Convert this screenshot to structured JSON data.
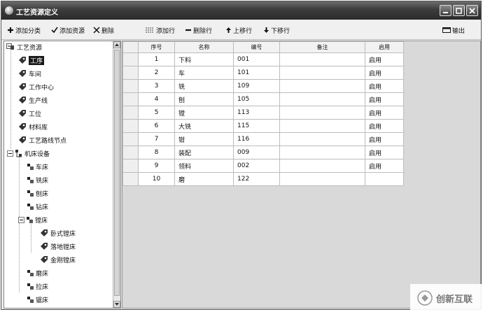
{
  "window": {
    "title": "工艺资源定义"
  },
  "toolbar": {
    "add_category": "添加分类",
    "add_resource": "添加资源",
    "delete": "删除",
    "add_row": "添加行",
    "delete_row": "删除行",
    "move_up": "上移行",
    "move_down": "下移行",
    "export": "输出"
  },
  "tree": {
    "root": "工艺资源",
    "nodes": [
      {
        "label": "工序",
        "selected": true
      },
      {
        "label": "车间"
      },
      {
        "label": "工作中心"
      },
      {
        "label": "生产线"
      },
      {
        "label": "工位"
      },
      {
        "label": "材料库"
      },
      {
        "label": "工艺路线节点"
      },
      {
        "label": "机床设备"
      },
      {
        "label": "车床"
      },
      {
        "label": "铣床"
      },
      {
        "label": "刨床"
      },
      {
        "label": "钻床"
      },
      {
        "label": "镗床"
      },
      {
        "label": "卧式镗床"
      },
      {
        "label": "落地镗床"
      },
      {
        "label": "金刚镗床"
      },
      {
        "label": "磨床"
      },
      {
        "label": "拉床"
      },
      {
        "label": "锯床"
      }
    ]
  },
  "grid": {
    "headers": [
      "序号",
      "名称",
      "编号",
      "备注",
      "启用"
    ],
    "rows": [
      {
        "no": "1",
        "name": "下料",
        "code": "001",
        "remark": "",
        "enabled": "启用"
      },
      {
        "no": "2",
        "name": "车",
        "code": "101",
        "remark": "",
        "enabled": "启用"
      },
      {
        "no": "3",
        "name": "铣",
        "code": "109",
        "remark": "",
        "enabled": "启用"
      },
      {
        "no": "4",
        "name": "刨",
        "code": "105",
        "remark": "",
        "enabled": "启用"
      },
      {
        "no": "5",
        "name": "镗",
        "code": "113",
        "remark": "",
        "enabled": "启用"
      },
      {
        "no": "6",
        "name": "大铣",
        "code": "115",
        "remark": "",
        "enabled": "启用"
      },
      {
        "no": "7",
        "name": "钳",
        "code": "116",
        "remark": "",
        "enabled": "启用"
      },
      {
        "no": "8",
        "name": "装配",
        "code": "009",
        "remark": "",
        "enabled": "启用"
      },
      {
        "no": "9",
        "name": "领料",
        "code": "002",
        "remark": "",
        "enabled": "启用"
      },
      {
        "no": "10",
        "name": "磨",
        "code": "122",
        "remark": "",
        "enabled": ""
      }
    ]
  },
  "watermark": {
    "text": "创新互联"
  }
}
